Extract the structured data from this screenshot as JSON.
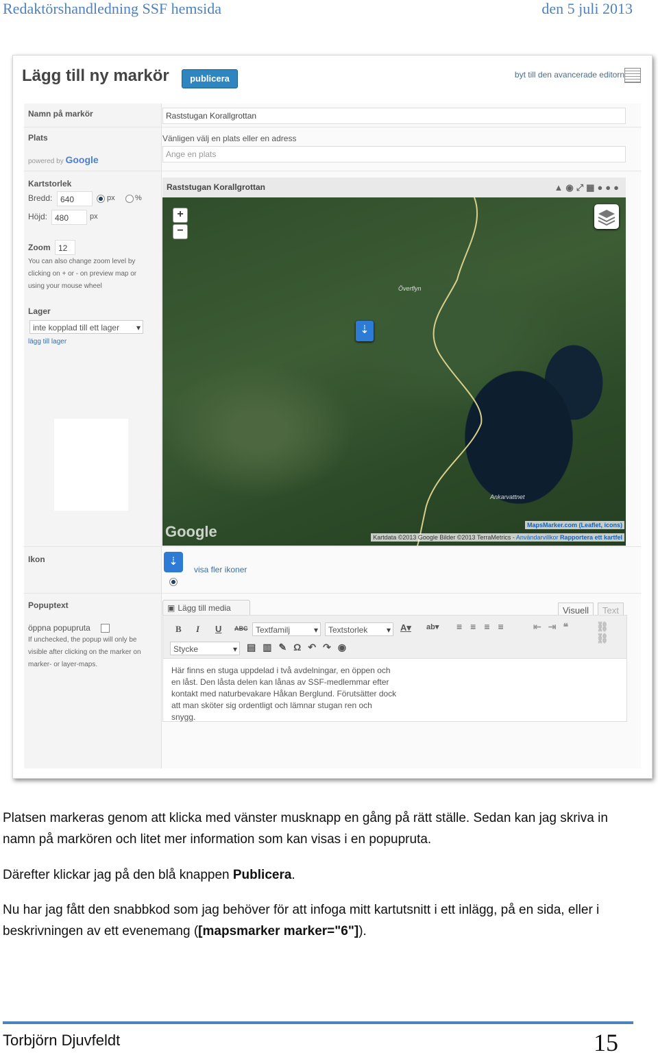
{
  "header": {
    "left": "Redaktörshandledning SSF hemsida",
    "right": "den 5 juli 2013"
  },
  "screenshot": {
    "title": "Lägg till ny markör",
    "publish_button": "publicera",
    "switch_editor": "byt till den avancerade editorn",
    "fields": {
      "name_label": "Namn på markör",
      "name_value": "Raststugan Korallgrottan",
      "place_label": "Plats",
      "place_hint": "Vänligen välj en plats eller en adress",
      "place_placeholder": "Ange en plats",
      "powered_by": "powered by",
      "powered_brand": "Google",
      "mapsize_label": "Kartstorlek",
      "width_label": "Bredd:",
      "width_value": "640",
      "unit_px": "px",
      "unit_pct": "%",
      "height_label": "Höjd:",
      "height_value": "480",
      "height_unit": "px",
      "zoom_label": "Zoom",
      "zoom_value": "12",
      "zoom_help": "You can also change zoom level by clicking on + or - on preview map or using your mouse wheel",
      "layer_label": "Lager",
      "layer_value": "inte kopplad till ett lager",
      "layer_add": "lägg till lager",
      "icon_label": "Ikon",
      "icon_more": "visa fler ikoner",
      "popup_label": "Popuptext",
      "popup_open": "öppna popupruta",
      "popup_help": "If unchecked, the popup will only be visible after clicking on the marker on marker- or layer-maps."
    },
    "map": {
      "header": "Raststugan Korallgrottan",
      "zoom_in": "+",
      "zoom_out": "−",
      "place1": "Överflyn",
      "place2": "Ankarvattnet",
      "google": "Google",
      "attrib1": "MapsMarker.com (Leaflet, icons)",
      "attrib2_prefix": "Kartdata ©2013 Google Bilder ©2013 TerraMetrics -",
      "attrib2_link": "Användarvillkor",
      "attrib2_report": "Rapportera ett kartfel"
    },
    "editor": {
      "media_button": "Lägg till media",
      "tab_visual": "Visuell",
      "tab_text": "Text",
      "font_family": "Textfamilj",
      "font_size": "Textstorlek",
      "format": "Stycke",
      "content": "Här finns en stuga uppdelad i två avdelningar, en öppen och en låst. Den låsta delen kan lånas av SSF-medlemmar efter kontakt med naturbevakare Håkan Berglund. Förutsätter dock att man sköter sig ordentligt och lämnar stugan ren och snygg."
    }
  },
  "body": {
    "p1": "Platsen markeras genom att klicka med vänster musknapp en gång på rätt ställe. Sedan kan jag skriva in namn på markören och litet mer information som kan visas i en popupruta.",
    "p2_prefix": "Därefter klickar jag på den blå knappen ",
    "p2_bold": "Publicera",
    "p2_suffix": ".",
    "p3_prefix": "Nu har jag fått den snabbkod som jag behöver för att infoga mitt kartutsnitt i ett inlägg, på en sida, eller i beskrivningen av ett evenemang (",
    "p3_bold": "[mapsmarker marker=\"6\"]",
    "p3_suffix": ")."
  },
  "footer": {
    "author": "Torbjörn Djuvfeldt",
    "page": "15"
  }
}
